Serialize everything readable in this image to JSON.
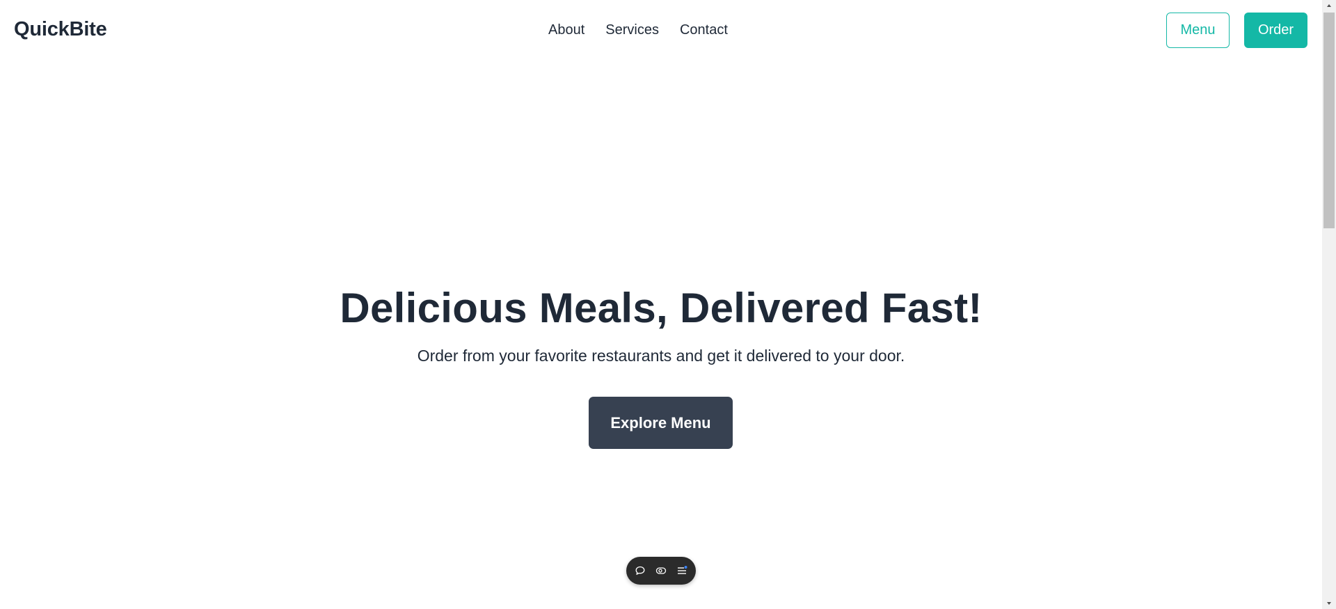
{
  "header": {
    "brand": "QuickBite",
    "nav": [
      "About",
      "Services",
      "Contact"
    ],
    "menu_button": "Menu",
    "order_button": "Order"
  },
  "hero": {
    "title": "Delicious Meals, Delivered Fast!",
    "subtitle": "Order from your favorite restaurants and get it delivered to your door.",
    "cta": "Explore Menu"
  },
  "toolbar": {
    "icons": [
      "chat-bubble-icon",
      "toggle-icon",
      "list-icon"
    ],
    "indicator_color": "#3b82f6"
  },
  "colors": {
    "accent": "#14b8a6",
    "text": "#1f2937",
    "cta_bg": "#374151"
  }
}
